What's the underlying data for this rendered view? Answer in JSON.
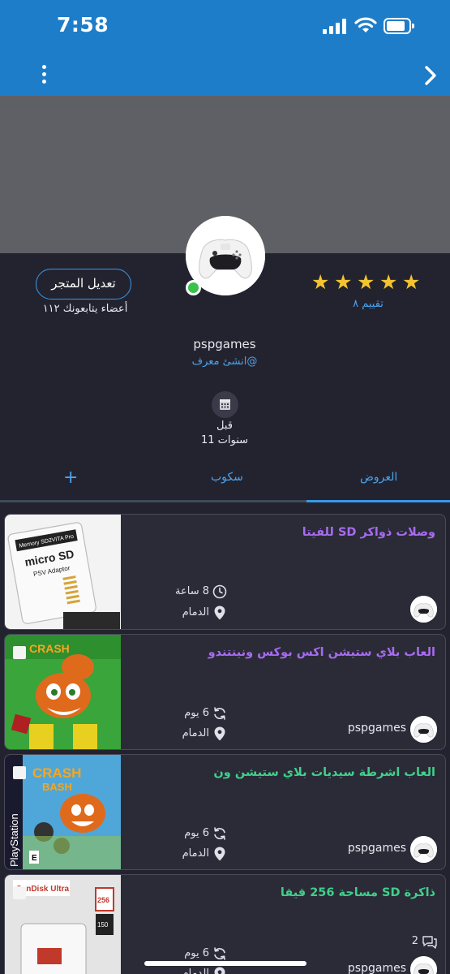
{
  "status_bar": {
    "time": "7:58"
  },
  "app_bar": {
    "menu_icon": "more-vertical-icon",
    "back_icon": "chevron-right-icon"
  },
  "colors": {
    "brand": "#1e7dc8",
    "accent": "#4aa3ee",
    "background": "#23232f",
    "star": "#f4c430",
    "online": "#37c24a",
    "title_purple": "#a76bf0",
    "title_green": "#3fd08a"
  },
  "store": {
    "edit_label": "تعديل المتجر",
    "followers_text": "أعضاء يتابعونك ١١٢",
    "rating": 5,
    "rating_text": "تقييم ٨",
    "username": "pspgames",
    "verify_text": "@انشئ معرف",
    "since_line1": "قبل",
    "since_line2": "11 سنوات"
  },
  "tabs": [
    {
      "label": "العروض",
      "active": true
    },
    {
      "label": "سكوب",
      "active": false
    },
    {
      "label": "+",
      "active": false
    }
  ],
  "listings": [
    {
      "title": "وصلات ذواكر SD للفيتا",
      "title_color": "purple",
      "time": "8 ساعة",
      "time_icon": "clock-icon",
      "location": "الدمام",
      "seller": "",
      "comments": ""
    },
    {
      "title": "العاب بلاي ستيشن اكس بوكس ونينتندو",
      "title_color": "purple",
      "time": "6 يوم",
      "time_icon": "refresh-icon",
      "location": "الدمام",
      "seller": "pspgames",
      "comments": ""
    },
    {
      "title": "العاب اشرطة سيديات بلاي ستيشن ون",
      "title_color": "green",
      "time": "6 يوم",
      "time_icon": "refresh-icon",
      "location": "الدمام",
      "seller": "pspgames",
      "comments": ""
    },
    {
      "title": "ذاكرة SD مساحة 256 قيقا",
      "title_color": "green",
      "time": "6 يوم",
      "time_icon": "refresh-icon",
      "location": "الدمام",
      "seller": "pspgames",
      "comments": "2"
    }
  ]
}
